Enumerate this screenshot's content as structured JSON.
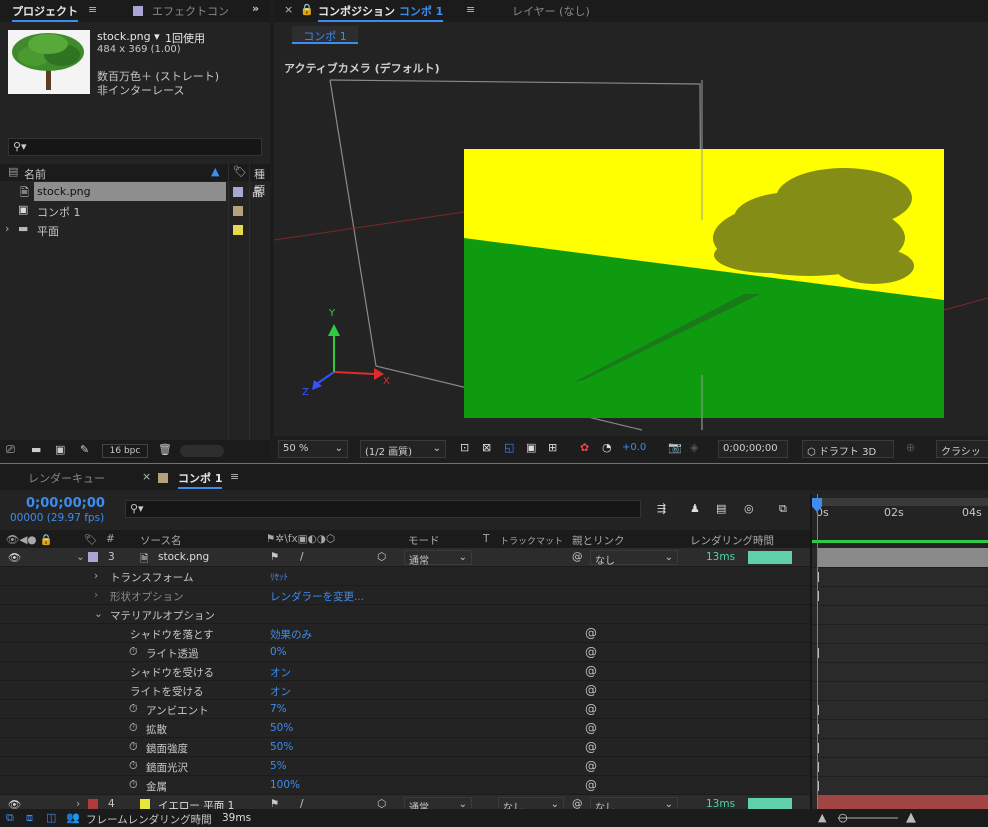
{
  "project": {
    "tab_project": "プロジェクト",
    "tab_effects": "エフェクトコン",
    "file_name": "stock.png ▾",
    "usage": "1回使用",
    "dimensions": "484 x 369 (1.00)",
    "color_info": "数百万色＋ (ストレート)",
    "field_info": "非インターレース",
    "col_name": "名前",
    "col_type": "種類",
    "items": [
      {
        "label": "stock.png",
        "color": "#a9a6d6"
      },
      {
        "label": "コンポ 1",
        "color": "#b6a27a"
      },
      {
        "label": "平面",
        "color": "#e8d84b"
      }
    ],
    "bpc": "16 bpc"
  },
  "comp": {
    "tab_comp_prefix": "コンポジション",
    "tab_comp_name": "コンポ 1",
    "tab_layer": "レイヤー (なし)",
    "subtab": "コンポ 1",
    "camera_label": "アクティブカメラ (デフォルト)",
    "axis_x": "X",
    "axis_y": "Y",
    "axis_z": "Z",
    "zoom": "50 %",
    "resolution": "(1/2 画質)",
    "exposure": "+0.0",
    "timecode": "0;00;00;00",
    "draft3d": "ドラフト 3D",
    "renderer": "クラシッ"
  },
  "timeline": {
    "tab_render_queue": "レンダーキュー",
    "tab_comp": "コンポ 1",
    "timecode": "0;00;00;00",
    "frames": "00000 (29.97 fps)",
    "headers": {
      "num": "#",
      "source": "ソース名",
      "mode": "モード",
      "t": "T",
      "trackmatte": "トラックマット",
      "parent": "親とリンク",
      "render_time": "レンダリング時間"
    },
    "ruler": [
      "0s",
      "02s",
      "04s"
    ],
    "layer3": {
      "num": "3",
      "name": "stock.png",
      "mode": "通常",
      "parent": "なし",
      "time": "13ms",
      "color": "#a9a6d6"
    },
    "transform": {
      "label": "トランスフォーム",
      "value": "ﾘｾｯﾄ"
    },
    "shape_options": {
      "label": "形状オプション",
      "value": "レンダラーを変更..."
    },
    "material_options": {
      "label": "マテリアルオプション"
    },
    "props": [
      {
        "label": "シャドウを落とす",
        "value": "効果のみ",
        "stopwatch": false,
        "key": false
      },
      {
        "label": "ライト透過",
        "value": "0%",
        "stopwatch": true,
        "key": true
      },
      {
        "label": "シャドウを受ける",
        "value": "オン",
        "stopwatch": false,
        "key": false
      },
      {
        "label": "ライトを受ける",
        "value": "オン",
        "stopwatch": false,
        "key": false
      },
      {
        "label": "アンビエント",
        "value": "7%",
        "stopwatch": true,
        "key": true
      },
      {
        "label": "拡散",
        "value": "50%",
        "stopwatch": true,
        "key": true
      },
      {
        "label": "鏡面強度",
        "value": "50%",
        "stopwatch": true,
        "key": true
      },
      {
        "label": "鏡面光沢",
        "value": "5%",
        "stopwatch": true,
        "key": true
      },
      {
        "label": "金属",
        "value": "100%",
        "stopwatch": true,
        "key": true
      }
    ],
    "layer4": {
      "num": "4",
      "name": "イエロー 平面 1",
      "mode": "通常",
      "trackmatte": "なし",
      "parent": "なし",
      "time": "13ms",
      "color": "#e8e63a",
      "label_color": "#b33a3a"
    },
    "footer": "フレームレンダリング時間",
    "footer_value": "39ms"
  }
}
